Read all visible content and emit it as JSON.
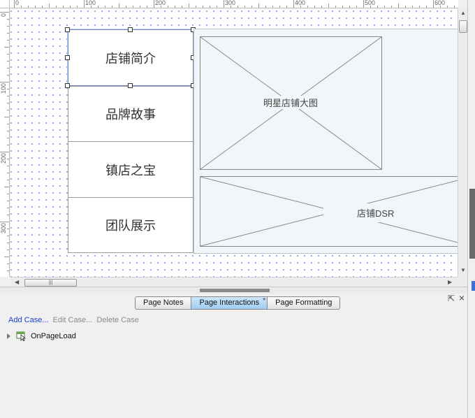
{
  "rulers": {
    "top": [
      "0",
      "100",
      "200",
      "300",
      "400",
      "500",
      "600"
    ],
    "left": [
      "0",
      "100",
      "200",
      "300"
    ]
  },
  "canvas": {
    "nav_items": [
      "店铺简介",
      "品牌故事",
      "镇店之宝",
      "团队展示"
    ],
    "placeholders": {
      "banner_label": "明星店铺大图",
      "dsr_label": "店铺DSR"
    }
  },
  "tabs": [
    {
      "label": "Page Notes",
      "active": false
    },
    {
      "label": "Page Interactions",
      "active": true,
      "badge": "*"
    },
    {
      "label": "Page Formatting",
      "active": false
    }
  ],
  "panel_controls": {
    "popout": "⇱",
    "close": "×"
  },
  "interactions": {
    "add_case": "Add Case...",
    "edit_case": "Edit Case...",
    "delete_case": "Delete Case",
    "events": [
      {
        "name": "OnPageLoad"
      }
    ]
  },
  "icons": {
    "expander": "triangle-right-icon",
    "event": "page-load-event-icon",
    "popout": "popout-icon",
    "close": "close-icon"
  }
}
